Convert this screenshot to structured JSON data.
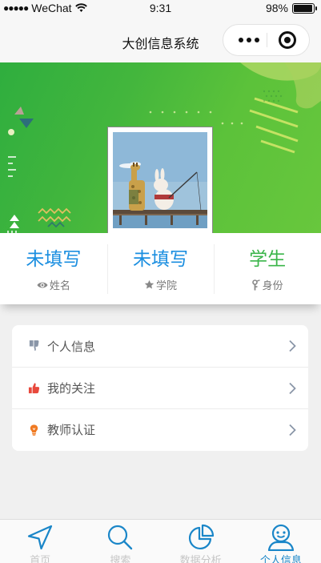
{
  "status_bar": {
    "signal_dots": "●●●●●",
    "carrier": "WeChat",
    "time": "9:31",
    "battery_pct": "98%",
    "battery_level": 0.98
  },
  "nav": {
    "title": "大创信息系统"
  },
  "profile": {
    "name": {
      "value": "未填写",
      "label": "姓名",
      "icon": "eye-icon",
      "color": "#1a8ee0"
    },
    "college": {
      "value": "未填写",
      "label": "学院",
      "icon": "star-icon",
      "color": "#1a8ee0"
    },
    "role": {
      "value": "学生",
      "label": "身份",
      "icon": "key-icon",
      "color": "#3bb54a"
    }
  },
  "menu": {
    "items": [
      {
        "label": "个人信息",
        "icon": "thumbs-down-icon",
        "icon_color": "#8a96a8"
      },
      {
        "label": "我的关注",
        "icon": "thumbs-up-icon",
        "icon_color": "#e8483c"
      },
      {
        "label": "教师认证",
        "icon": "lightbulb-icon",
        "icon_color": "#f07a22"
      }
    ]
  },
  "tabs": [
    {
      "label": "首页",
      "icon": "navigation-arrow-icon",
      "active": false
    },
    {
      "label": "搜索",
      "icon": "search-icon",
      "active": false
    },
    {
      "label": "数据分析",
      "icon": "pie-chart-icon",
      "active": false
    },
    {
      "label": "个人信息",
      "icon": "user-icon",
      "active": true
    }
  ],
  "colors": {
    "accent_blue": "#1a86c8",
    "banner_green": "#4cb93b",
    "role_green": "#3bb54a"
  }
}
